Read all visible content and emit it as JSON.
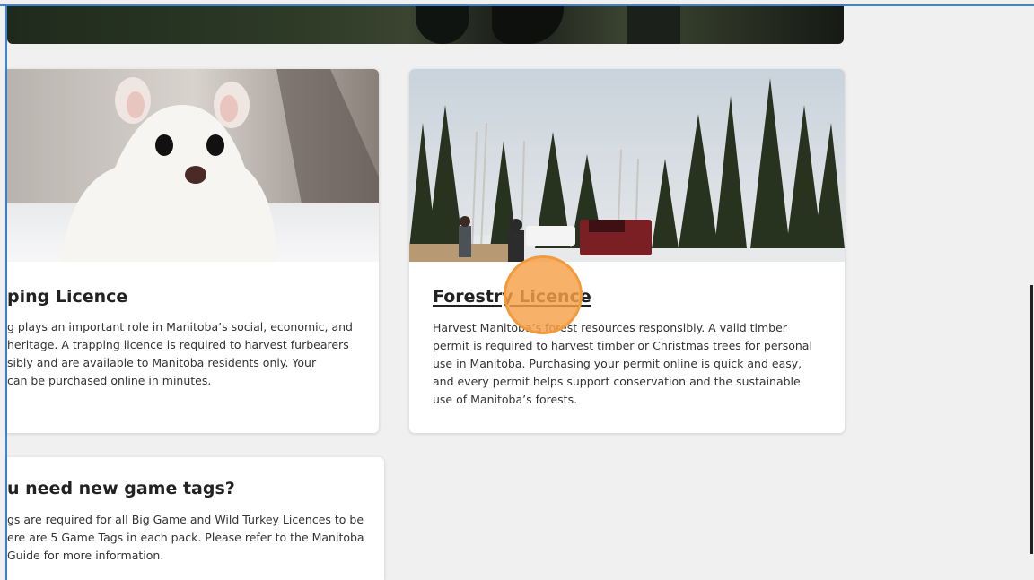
{
  "cards": {
    "trapping": {
      "title": "ping Licence",
      "lines": [
        "g plays an important role in Manitoba’s social, economic, and",
        " heritage. A trapping licence is required to harvest furbearers",
        "sibly and are available to Manitoba residents only. Your",
        "can be purchased online in minutes."
      ],
      "image_icon": "ermine-photo"
    },
    "forestry": {
      "title": "Forestry Licence",
      "lines": [
        "Harvest Manitoba’s forest resources responsibly. A valid timber",
        "permit is required to harvest timber or Christmas trees for personal",
        "use in Manitoba. Purchasing your permit online is quick and easy,",
        "and every permit helps support conservation and the sustainable",
        "use of Manitoba’s forests."
      ],
      "image_icon": "forest-harvest-photo"
    },
    "game_tags": {
      "title": "u need new game tags?",
      "lines": [
        "gs are required for all Big Game and Wild Turkey Licences to be",
        "ere are 5 Game Tags in each pack. Please refer to the Manitoba",
        " Guide for more information."
      ]
    }
  },
  "hero": {
    "image_icon": "hunters-hero-photo"
  },
  "colors": {
    "page_background": "#f0f0f0",
    "card_background": "#ffffff",
    "click_indicator": "#f39a3c",
    "frame_accent": "#3b86d1"
  }
}
